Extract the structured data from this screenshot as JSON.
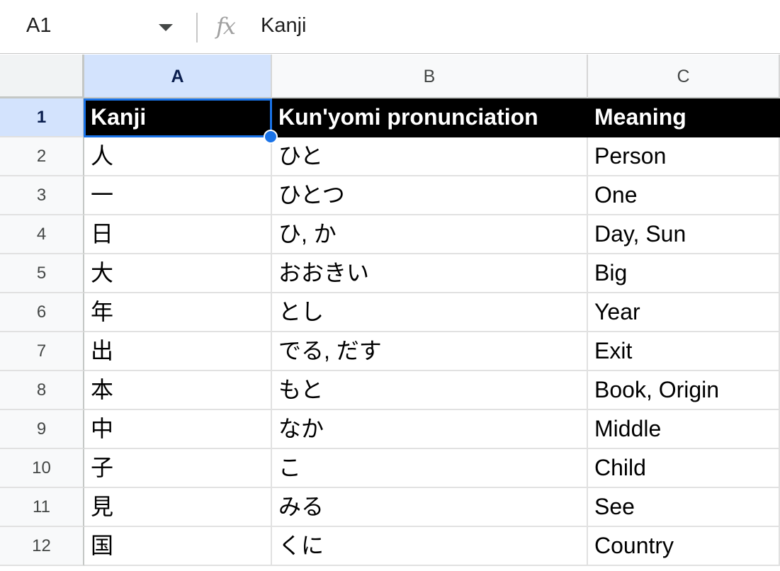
{
  "formula_bar": {
    "name_box": "A1",
    "fx_label": "fx",
    "value": "Kanji"
  },
  "columns": [
    "A",
    "B",
    "C"
  ],
  "rows": [
    {
      "num": "1",
      "cells": [
        "Kanji",
        "Kun'yomi pronunciation",
        "Meaning"
      ]
    },
    {
      "num": "2",
      "cells": [
        "人",
        "ひと",
        "Person"
      ]
    },
    {
      "num": "3",
      "cells": [
        "一",
        "ひとつ",
        "One"
      ]
    },
    {
      "num": "4",
      "cells": [
        "日",
        "ひ, か",
        "Day, Sun"
      ]
    },
    {
      "num": "5",
      "cells": [
        "大",
        "おおきい",
        "Big"
      ]
    },
    {
      "num": "6",
      "cells": [
        "年",
        "とし",
        "Year"
      ]
    },
    {
      "num": "7",
      "cells": [
        "出",
        "でる, だす",
        "Exit"
      ]
    },
    {
      "num": "8",
      "cells": [
        "本",
        "もと",
        "Book, Origin"
      ]
    },
    {
      "num": "9",
      "cells": [
        "中",
        "なか",
        "Middle"
      ]
    },
    {
      "num": "10",
      "cells": [
        "子",
        "こ",
        "Child"
      ]
    },
    {
      "num": "11",
      "cells": [
        "見",
        "みる",
        "See"
      ]
    },
    {
      "num": "12",
      "cells": [
        "国",
        "くに",
        "Country"
      ]
    }
  ],
  "selection": {
    "column": "A",
    "row": "1"
  },
  "colors": {
    "accent": "#1a73e8",
    "selected_header": "#d3e3fd",
    "header_row_bg": "#000000",
    "header_row_text": "#ffffff"
  }
}
